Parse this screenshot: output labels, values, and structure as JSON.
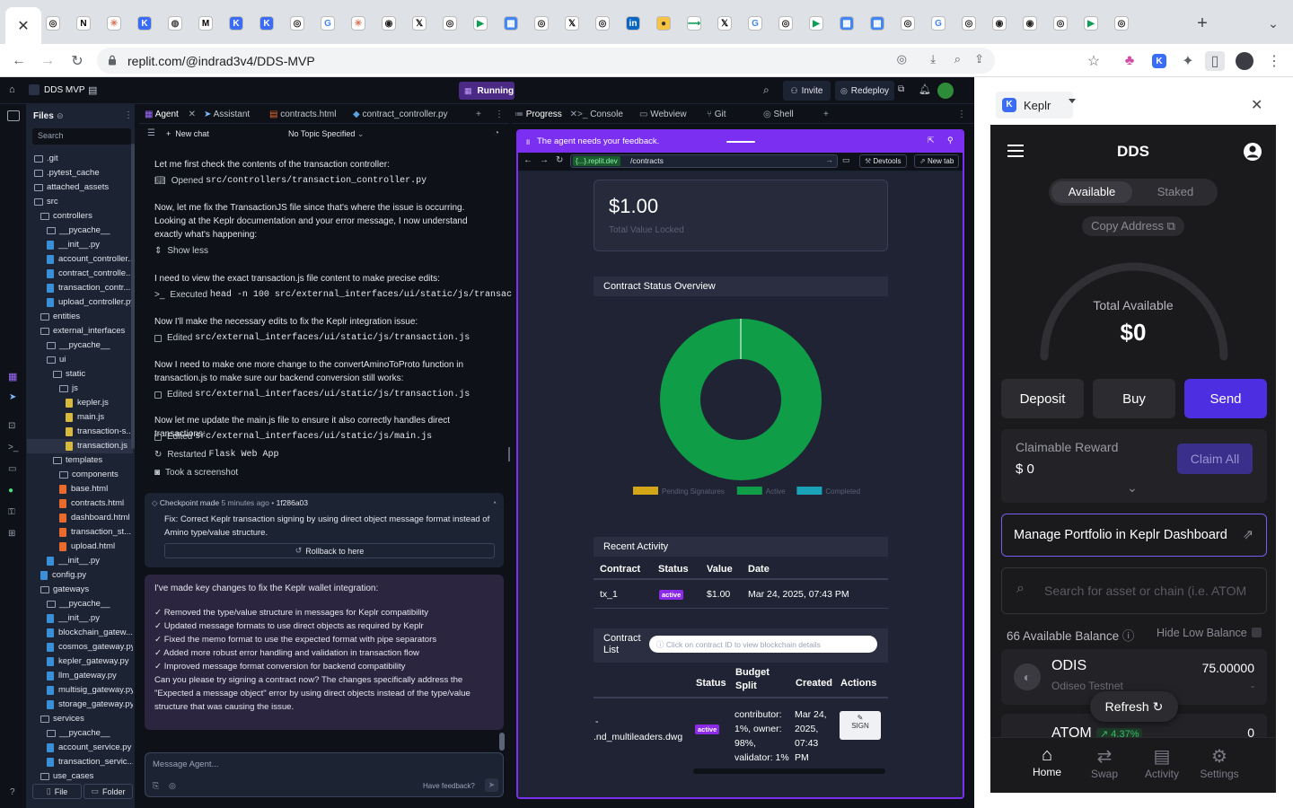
{
  "browser": {
    "tab_icons": [
      "openai",
      "notion",
      "claude",
      "keplr",
      "globe",
      "medium",
      "keplr",
      "keplr",
      "openai",
      "google",
      "claude",
      "github",
      "x",
      "openai",
      "meet",
      "calendar",
      "openai",
      "x",
      "openai",
      "linkedin",
      "poe",
      "route",
      "x",
      "google",
      "openai",
      "meet",
      "calendar",
      "calendar",
      "openai",
      "google",
      "openai",
      "github",
      "github",
      "openai",
      "meet",
      "openai"
    ],
    "url": "replit.com/@indrad3v4/DDS-MVP",
    "new_tab": "+"
  },
  "replit": {
    "project_name": "DDS MVP",
    "status": "Running",
    "invite": "Invite",
    "redeploy": "Redeploy",
    "files_title": "Files",
    "search_placeholder": "Search",
    "tree": [
      {
        "name": ".git",
        "depth": 0,
        "type": "folder"
      },
      {
        "name": ".pytest_cache",
        "depth": 0,
        "type": "folder"
      },
      {
        "name": "attached_assets",
        "depth": 0,
        "type": "folder"
      },
      {
        "name": "src",
        "depth": 0,
        "type": "folder"
      },
      {
        "name": "controllers",
        "depth": 1,
        "type": "folder"
      },
      {
        "name": "__pycache__",
        "depth": 2,
        "type": "folder"
      },
      {
        "name": "__init__.py",
        "depth": 2,
        "type": "py"
      },
      {
        "name": "account_controller...",
        "depth": 2,
        "type": "py"
      },
      {
        "name": "contract_controlle...",
        "depth": 2,
        "type": "py"
      },
      {
        "name": "transaction_contr...",
        "depth": 2,
        "type": "py"
      },
      {
        "name": "upload_controller.py",
        "depth": 2,
        "type": "py"
      },
      {
        "name": "entities",
        "depth": 1,
        "type": "folder"
      },
      {
        "name": "external_interfaces",
        "depth": 1,
        "type": "folder"
      },
      {
        "name": "__pycache__",
        "depth": 2,
        "type": "folder"
      },
      {
        "name": "ui",
        "depth": 2,
        "type": "folder"
      },
      {
        "name": "static",
        "depth": 3,
        "type": "folder"
      },
      {
        "name": "js",
        "depth": 4,
        "type": "folder"
      },
      {
        "name": "kepler.js",
        "depth": 5,
        "type": "js"
      },
      {
        "name": "main.js",
        "depth": 5,
        "type": "js"
      },
      {
        "name": "transaction-s...",
        "depth": 5,
        "type": "js"
      },
      {
        "name": "transaction.js",
        "depth": 5,
        "type": "js"
      },
      {
        "name": "templates",
        "depth": 3,
        "type": "folder"
      },
      {
        "name": "components",
        "depth": 4,
        "type": "folder"
      },
      {
        "name": "base.html",
        "depth": 4,
        "type": "html"
      },
      {
        "name": "contracts.html",
        "depth": 4,
        "type": "html"
      },
      {
        "name": "dashboard.html",
        "depth": 4,
        "type": "html"
      },
      {
        "name": "transaction_st...",
        "depth": 4,
        "type": "html"
      },
      {
        "name": "upload.html",
        "depth": 4,
        "type": "html"
      },
      {
        "name": "__init__.py",
        "depth": 2,
        "type": "py"
      },
      {
        "name": "config.py",
        "depth": 1,
        "type": "py"
      },
      {
        "name": "gateways",
        "depth": 1,
        "type": "folder"
      },
      {
        "name": "__pycache__",
        "depth": 2,
        "type": "folder"
      },
      {
        "name": "__init__.py",
        "depth": 2,
        "type": "py"
      },
      {
        "name": "blockchain_gatew...",
        "depth": 2,
        "type": "py"
      },
      {
        "name": "cosmos_gateway.py",
        "depth": 2,
        "type": "py"
      },
      {
        "name": "kepler_gateway.py",
        "depth": 2,
        "type": "py"
      },
      {
        "name": "llm_gateway.py",
        "depth": 2,
        "type": "py"
      },
      {
        "name": "multisig_gateway.py",
        "depth": 2,
        "type": "py"
      },
      {
        "name": "storage_gateway.py",
        "depth": 2,
        "type": "py"
      },
      {
        "name": "services",
        "depth": 1,
        "type": "folder"
      },
      {
        "name": "__pycache__",
        "depth": 2,
        "type": "folder"
      },
      {
        "name": "account_service.py",
        "depth": 2,
        "type": "py"
      },
      {
        "name": "transaction_servic...",
        "depth": 2,
        "type": "py"
      },
      {
        "name": "use_cases",
        "depth": 1,
        "type": "folder"
      }
    ],
    "file_btn": "File",
    "folder_btn": "Folder",
    "editor_tabs": [
      "Agent",
      "Assistant",
      "contracts.html",
      "contract_controller.py"
    ],
    "new_chat": "New chat",
    "topic": "No Topic Specified",
    "messages": {
      "m1": "Let me first check the contents of the transaction controller:",
      "a1_label": "Opened",
      "a1_path": "src/controllers/transaction_controller.py",
      "m2": "Now, let me fix the TransactionJS file since that's where the issue is occurring. Looking at the Keplr documentation and your error message, I now understand exactly what's happening:",
      "show_less": "Show less",
      "m3": "I need to view the exact transaction.js file content to make precise edits:",
      "a3_label": "Executed",
      "a3_cmd": "head -n 100 src/external_interfaces/ui/static/js/transac…",
      "m4": "Now I'll make the necessary edits to fix the Keplr integration issue:",
      "a4_label": "Edited",
      "a4_path": "src/external_interfaces/ui/static/js/transaction.js",
      "m5": "Now I need to make one more change to the convertAminoToProto function in transaction.js to make sure our backend conversion still works:",
      "a5_label": "Edited",
      "a5_path": "src/external_interfaces/ui/static/js/transaction.js",
      "m6": "Now let me update the main.js file to ensure it also correctly handles direct transactions:",
      "a6_label": "Edited",
      "a6_path": "src/external_interfaces/ui/static/js/main.js",
      "a7_label": "Restarted",
      "a7_name": "Flask Web App",
      "a8": "Took a screenshot"
    },
    "checkpoint": {
      "header_prefix": "Checkpoint made",
      "time": "5 minutes ago",
      "hash": "1f286a03",
      "text": "Fix: Correct Keplr transaction signing by using direct object message format instead of Amino type/value structure.",
      "rollback": "Rollback to here"
    },
    "summary": {
      "intro": "I've made key changes to fix the Keplr wallet integration:",
      "items": [
        "✓ Removed the type/value structure in messages for Keplr compatibility",
        "✓ Updated message formats to use direct objects as required by Keplr",
        "✓ Fixed the memo format to use the expected format with pipe separators",
        "✓ Added more robust error handling and validation in transaction flow",
        "✓ Improved message format conversion for backend compatibility"
      ],
      "outro": "Can you please try signing a contract now? The changes specifically address the \"Expected a message object\" error by using direct objects instead of the type/value structure that was causing the issue."
    },
    "input_placeholder": "Message Agent...",
    "have_feedback": "Have feedback?",
    "right_tabs": [
      "Progress",
      "Console",
      "Webview",
      "Git",
      "Shell"
    ],
    "feedback_banner": "The agent needs your feedback.",
    "webview": {
      "domain": "{...}.replit.dev",
      "path": "/contracts",
      "devtools": "Devtools",
      "new_tab": "New tab"
    }
  },
  "site": {
    "tvl_value": "$1.00",
    "tvl_label": "Total Value Locked",
    "status_title": "Contract Status Overview",
    "legend": [
      {
        "label": "Pending Signatures",
        "color": "#d4a516"
      },
      {
        "label": "Active",
        "color": "#0f9d47"
      },
      {
        "label": "Completed",
        "color": "#1aa3b8"
      }
    ],
    "recent_title": "Recent Activity",
    "recent_headers": [
      "Contract",
      "Status",
      "Value",
      "Date"
    ],
    "recent_rows": [
      [
        "tx_1",
        "active",
        "$1.00",
        "Mar 24, 2025, 07:43 PM"
      ]
    ],
    "contract_list_title": "Contract List",
    "contract_search_placeholder": "Click on contract ID to view blockchain details",
    "list_headers": [
      "Status",
      "Budget Split",
      "Created",
      "Actions"
    ],
    "list_row": {
      "file": ".nd_multileaders.dwg",
      "file_prefix": "-",
      "status": "active",
      "split": "contributor: 1%, owner: 98%, validator: 1%",
      "created": "Mar 24, 2025, 07:43 PM",
      "action": "SIGN"
    }
  },
  "chart_data": {
    "type": "pie",
    "categories": [
      "Pending Signatures",
      "Active",
      "Completed"
    ],
    "values": [
      0,
      1,
      0
    ],
    "colors": [
      "#d4a516",
      "#0f9d47",
      "#1aa3b8"
    ],
    "title": "Contract Status Overview",
    "legend_position": "bottom"
  },
  "keplr": {
    "ext_title": "Keplr",
    "title": "DDS",
    "toggle": [
      "Available",
      "Staked"
    ],
    "copy_address": "Copy Address",
    "total_label": "Total Available",
    "total_value": "$0",
    "buttons": {
      "deposit": "Deposit",
      "buy": "Buy",
      "send": "Send"
    },
    "claim_label": "Claimable Reward",
    "claim_value": "$ 0",
    "claim_all": "Claim All",
    "manage": "Manage Portfolio in Keplr Dashboard",
    "search_placeholder": "Search for asset or chain (i.e. ATOM",
    "available_balance": "66 Available Balance",
    "hide_low": "Hide Low Balance",
    "assets": [
      {
        "name": "ODIS",
        "chain": "Odiseo Testnet",
        "amount": "75.00000",
        "fiat": "-"
      },
      {
        "name": "ATOM",
        "change": "4.37%",
        "amount": "0"
      }
    ],
    "refresh": "Refresh",
    "nav": [
      "Home",
      "Swap",
      "Activity",
      "Settings"
    ],
    "accent": "#4d2ee0"
  }
}
